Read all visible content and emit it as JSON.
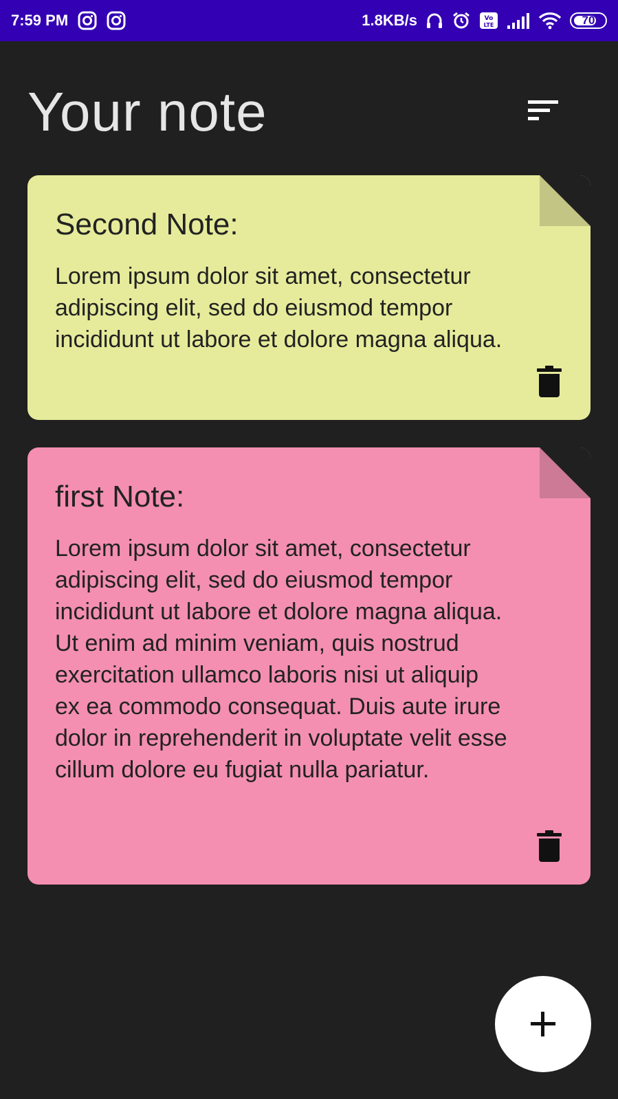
{
  "status_bar": {
    "time": "7:59 PM",
    "network_speed": "1.8KB/s",
    "battery_level": "70",
    "battery_fraction": 0.7,
    "icons": [
      "instagram-icon",
      "instagram-icon",
      "headset-icon",
      "alarm-icon",
      "volte-icon",
      "signal-icon",
      "wifi-icon",
      "battery-icon"
    ]
  },
  "header": {
    "title": "Your note",
    "sort_icon": "sort-icon"
  },
  "notes": [
    {
      "title": "Second Note:",
      "body": "Lorem ipsum dolor sit amet, consectetur adipiscing elit, sed do eiusmod tempor incididunt ut labore et dolore magna aliqua.",
      "color": "#E6EB9B",
      "fold_color": "#C2C583",
      "delete_icon": "trash-icon"
    },
    {
      "title": "first Note:",
      "body": "Lorem ipsum dolor sit amet, consectetur adipiscing elit, sed do eiusmod tempor incididunt ut labore et dolore magna aliqua. Ut enim ad minim veniam, quis nostrud exercitation ullamco laboris nisi ut aliquip ex ea commodo consequat. Duis aute irure dolor in reprehenderit in voluptate velit esse cillum dolore eu fugiat nulla pariatur.",
      "color": "#F48FB1",
      "fold_color": "#CC7A96",
      "delete_icon": "trash-icon"
    }
  ],
  "fab": {
    "icon": "plus-icon"
  }
}
